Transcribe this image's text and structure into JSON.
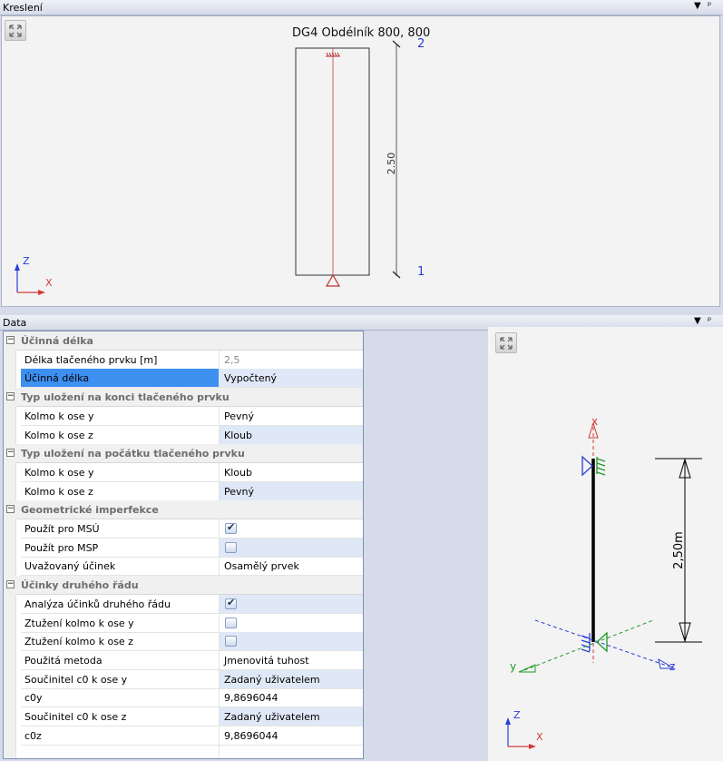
{
  "drawing_panel": {
    "title": "Kreslení",
    "pin_label": "▼ ⊥",
    "drawing_title": "DG4 Obdélník 800, 800",
    "dimension_label": "2.50",
    "node_top": "2",
    "node_bottom": "1",
    "axis_z": "Z",
    "axis_x": "X"
  },
  "data_panel": {
    "title": "Data",
    "pin_label": "▼ ⊥"
  },
  "groups": [
    {
      "title": "Účinná délka",
      "rows": [
        {
          "label": "Délka tlačeného prvku [m]",
          "value": "2,5"
        },
        {
          "label": "Účinná délka",
          "value": "Vypočtený"
        }
      ]
    },
    {
      "title": "Typ uložení na konci tlačeného prvku",
      "rows": [
        {
          "label": "Kolmo k ose y",
          "value": "Pevný"
        },
        {
          "label": "Kolmo k ose z",
          "value": "Kloub"
        }
      ]
    },
    {
      "title": "Typ uložení na počátku tlačeného prvku",
      "rows": [
        {
          "label": "Kolmo k ose y",
          "value": "Kloub"
        },
        {
          "label": "Kolmo k ose z",
          "value": "Pevný"
        }
      ]
    },
    {
      "title": "Geometrické imperfekce",
      "rows": [
        {
          "label": "Použít pro MSÚ",
          "checked": true
        },
        {
          "label": "Použít pro MSP",
          "checked": false
        },
        {
          "label": "Uvažovaný účinek",
          "value": "Osamělý prvek"
        }
      ]
    },
    {
      "title": "Účinky druhého řádu",
      "rows": [
        {
          "label": "Analýza účinků druhého řádu",
          "checked": true
        },
        {
          "label": "Ztužení kolmo k ose y",
          "checked": false
        },
        {
          "label": "Ztužení kolmo k ose z",
          "checked": false
        },
        {
          "label": "Použitá metoda",
          "value": "Jmenovitá tuhost"
        },
        {
          "label": "Součinitel c0 k ose y",
          "value": "Zadaný uživatelem"
        },
        {
          "label": "c0y",
          "value": "9,8696044"
        },
        {
          "label": "Součinitel c0 k ose z",
          "value": "Zadaný uživatelem"
        },
        {
          "label": "c0z",
          "value": "9,8696044"
        }
      ]
    }
  ],
  "preview": {
    "dimension_label": "2,50m",
    "axis_x": "x",
    "axis_y": "y",
    "axis_z": "z",
    "corner_z": "Z",
    "corner_x": "X"
  },
  "colors": {
    "selection": "#3d8ff0",
    "value_alt_bg": "#dfe8f6",
    "member_red": "#d23b3b",
    "axis_blue": "#2a3fd6",
    "axis_green": "#1f9a2a"
  }
}
